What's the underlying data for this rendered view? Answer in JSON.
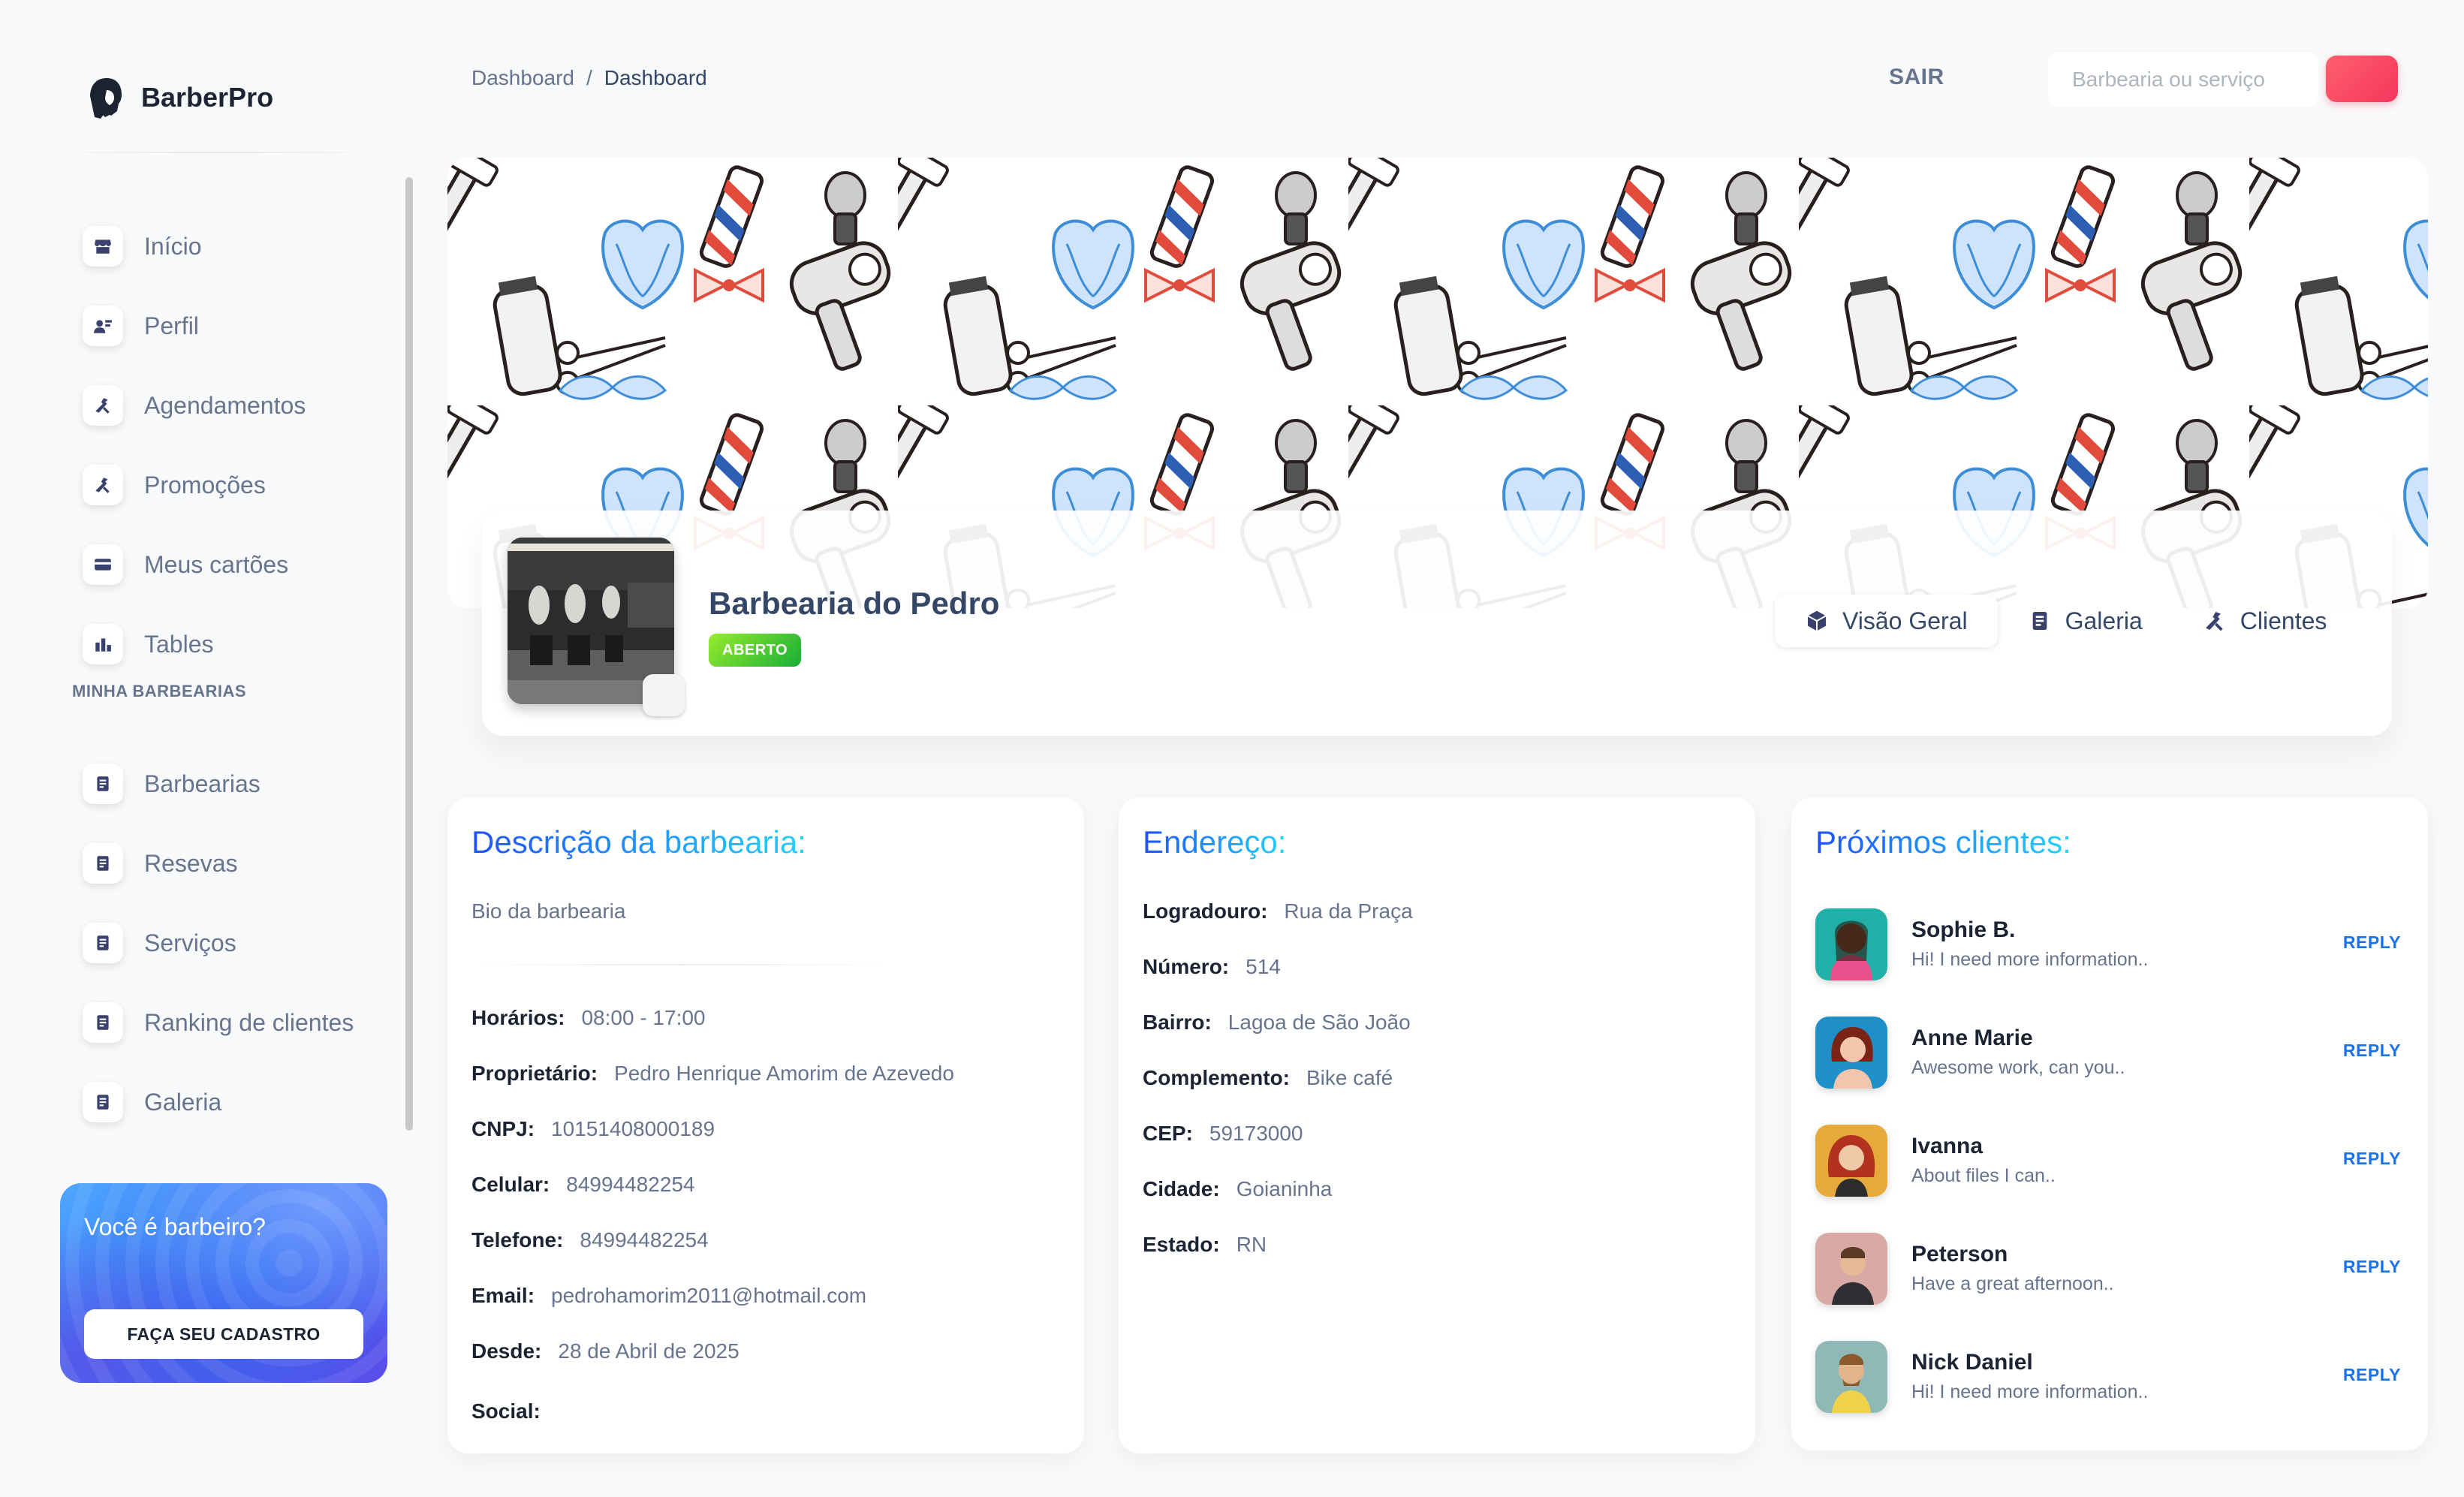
{
  "brand": {
    "name": "BarberPro"
  },
  "sidebar": {
    "items": [
      {
        "label": "Início",
        "icon": "shop-icon"
      },
      {
        "label": "Perfil",
        "icon": "profile-icon"
      },
      {
        "label": "Agendamentos",
        "icon": "tools-icon"
      },
      {
        "label": "Promoções",
        "icon": "tools-icon"
      },
      {
        "label": "Meus cartões",
        "icon": "credit-card-icon"
      },
      {
        "label": "Tables",
        "icon": "table-icon"
      }
    ],
    "section_title": "MINHA BARBEARIAS",
    "section_items": [
      {
        "label": "Barbearias",
        "icon": "document-icon"
      },
      {
        "label": "Resevas",
        "icon": "document-icon"
      },
      {
        "label": "Serviços",
        "icon": "document-icon"
      },
      {
        "label": "Ranking de clientes",
        "icon": "document-icon"
      },
      {
        "label": "Galeria",
        "icon": "document-icon"
      }
    ],
    "cta": {
      "title": "Você é barbeiro?",
      "button": "FAÇA SEU CADASTRO"
    }
  },
  "header": {
    "breadcrumb": [
      "Dashboard",
      "Dashboard"
    ],
    "breadcrumb_sep": "/",
    "logout": "SAIR",
    "search_placeholder": "Barbearia ou serviço"
  },
  "profile": {
    "name": "Barbearia do Pedro",
    "status": "ABERTO",
    "tabs": [
      "Visão Geral",
      "Galeria",
      "Clientes"
    ]
  },
  "description": {
    "title": "Descrição da barbearia:",
    "bio": "Bio da barbearia",
    "fields": [
      {
        "k": "Horários:",
        "v": "08:00 - 17:00"
      },
      {
        "k": "Proprietário:",
        "v": "Pedro Henrique Amorim de Azevedo"
      },
      {
        "k": "CNPJ:",
        "v": "10151408000189"
      },
      {
        "k": "Celular:",
        "v": "84994482254"
      },
      {
        "k": "Telefone:",
        "v": "84994482254"
      },
      {
        "k": "Email:",
        "v": "pedrohamorim2011@hotmail.com"
      },
      {
        "k": "Desde:",
        "v": "28 de Abril de 2025"
      },
      {
        "k": "Social:",
        "v": ""
      }
    ]
  },
  "address": {
    "title": "Endereço:",
    "fields": [
      {
        "k": "Logradouro:",
        "v": "Rua da Praça"
      },
      {
        "k": "Número:",
        "v": "514"
      },
      {
        "k": "Bairro:",
        "v": "Lagoa de São João"
      },
      {
        "k": "Complemento:",
        "v": "Bike café"
      },
      {
        "k": "CEP:",
        "v": "59173000"
      },
      {
        "k": "Cidade:",
        "v": "Goianinha"
      },
      {
        "k": "Estado:",
        "v": "RN"
      }
    ]
  },
  "clients": {
    "title": "Próximos clientes:",
    "reply_label": "REPLY",
    "list": [
      {
        "name": "Sophie B.",
        "msg": "Hi! I need more information.."
      },
      {
        "name": "Anne Marie",
        "msg": "Awesome work, can you.."
      },
      {
        "name": "Ivanna",
        "msg": "About files I can.."
      },
      {
        "name": "Peterson",
        "msg": "Have a great afternoon.."
      },
      {
        "name": "Nick Daniel",
        "msg": "Hi! I need more information.."
      }
    ]
  },
  "colors": {
    "accent": "#2152ff",
    "accent2": "#21d4fd",
    "open": "#17ad37",
    "search_button": "#f5365c",
    "text": "#344767",
    "muted": "#67748e"
  }
}
